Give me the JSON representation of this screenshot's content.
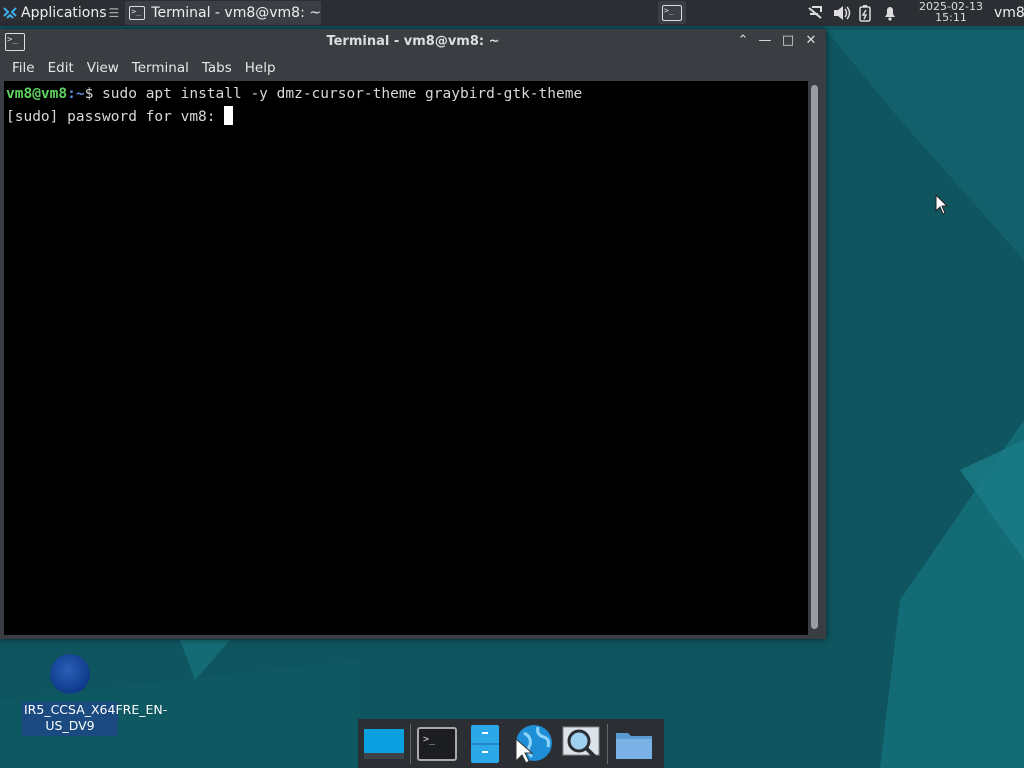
{
  "panel": {
    "applications_label": "Applications",
    "task_title": "Terminal - vm8@vm8: ~",
    "clock_date": "2025-02-13",
    "clock_time": "15:11",
    "user": "vm8"
  },
  "window": {
    "title": "Terminal - vm8@vm8: ~",
    "menu": [
      "File",
      "Edit",
      "View",
      "Terminal",
      "Tabs",
      "Help"
    ],
    "controls": {
      "keep_above": "⌃",
      "minimize": "—",
      "maximize": "□",
      "close": "✕"
    }
  },
  "terminal": {
    "prompt_user": "vm8@vm8",
    "prompt_path": ":~",
    "prompt_symbol": "$",
    "command": " sudo apt install -y dmz-cursor-theme graybird-gtk-theme",
    "password_prompt": "[sudo] password for vm8: "
  },
  "desktop": {
    "icon_label": "IR5_CCSA_X64FRE_EN-US_DV9"
  },
  "dock": {
    "items": [
      "show-desktop",
      "terminal",
      "file-cabinet",
      "web-browser",
      "app-finder",
      "home-folder"
    ]
  },
  "colors": {
    "panel_bg": "#2b2e33",
    "prompt_user": "#5fd35f",
    "prompt_path": "#5a8fe0",
    "desktop_bg": "#0f5560"
  }
}
